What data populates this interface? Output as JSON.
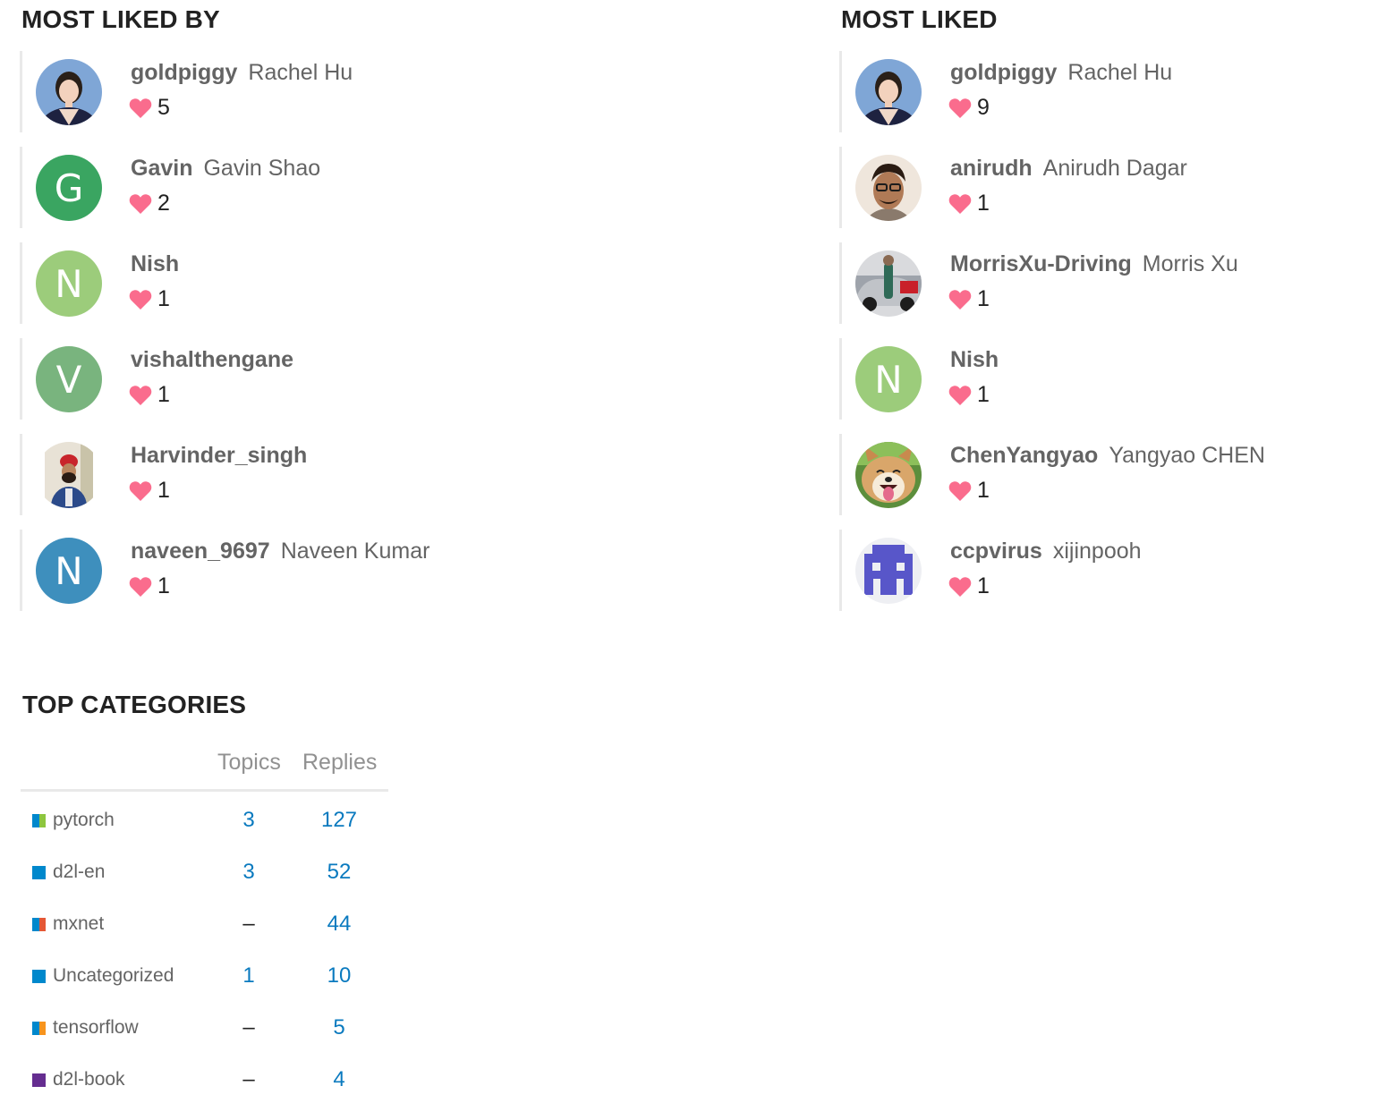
{
  "sections": {
    "most_liked_by": "MOST LIKED BY",
    "most_liked": "MOST LIKED",
    "top_categories": "TOP CATEGORIES"
  },
  "colors": {
    "heart": "#fa6c8d",
    "link": "#0a7abf",
    "muted": "#646464"
  },
  "most_liked_by": [
    {
      "username": "goldpiggy",
      "fullname": "Rachel Hu",
      "likes": "5",
      "avatar": "photo"
    },
    {
      "username": "Gavin",
      "fullname": "Gavin Shao",
      "likes": "2",
      "avatar": "letter",
      "letter": "G",
      "color": "#3aa561"
    },
    {
      "username": "Nish",
      "fullname": "",
      "likes": "1",
      "avatar": "letter",
      "letter": "N",
      "color": "#9ccc7b"
    },
    {
      "username": "vishalthengane",
      "fullname": "",
      "likes": "1",
      "avatar": "letter",
      "letter": "V",
      "color": "#79b47e"
    },
    {
      "username": "Harvinder_singh",
      "fullname": "",
      "likes": "1",
      "avatar": "photo"
    },
    {
      "username": "naveen_9697",
      "fullname": "Naveen Kumar",
      "likes": "1",
      "avatar": "letter",
      "letter": "N",
      "color": "#3e8fbd"
    }
  ],
  "most_liked": [
    {
      "username": "goldpiggy",
      "fullname": "Rachel Hu",
      "likes": "9",
      "avatar": "photo"
    },
    {
      "username": "anirudh",
      "fullname": "Anirudh Dagar",
      "likes": "1",
      "avatar": "photo"
    },
    {
      "username": "MorrisXu-Driving",
      "fullname": "Morris Xu",
      "likes": "1",
      "avatar": "photo"
    },
    {
      "username": "Nish",
      "fullname": "",
      "likes": "1",
      "avatar": "letter",
      "letter": "N",
      "color": "#9ccc7b"
    },
    {
      "username": "ChenYangyao",
      "fullname": "Yangyao CHEN",
      "likes": "1",
      "avatar": "photo"
    },
    {
      "username": "ccpvirus",
      "fullname": "xijinpooh",
      "likes": "1",
      "avatar": "identicon"
    }
  ],
  "categories": {
    "headers": {
      "topics": "Topics",
      "replies": "Replies"
    },
    "rows": [
      {
        "name": "pytorch",
        "topics": "3",
        "replies": "127",
        "colors": [
          "#0088cc",
          "#8dc63f"
        ]
      },
      {
        "name": "d2l-en",
        "topics": "3",
        "replies": "52",
        "colors": [
          "#0088cc"
        ]
      },
      {
        "name": "mxnet",
        "topics": "–",
        "replies": "44",
        "colors": [
          "#0088cc",
          "#e45735"
        ]
      },
      {
        "name": "Uncategorized",
        "topics": "1",
        "replies": "10",
        "colors": [
          "#0088cc"
        ]
      },
      {
        "name": "tensorflow",
        "topics": "–",
        "replies": "5",
        "colors": [
          "#0088cc",
          "#f7941d"
        ]
      },
      {
        "name": "d2l-book",
        "topics": "–",
        "replies": "4",
        "colors": [
          "#652d90"
        ]
      }
    ]
  }
}
